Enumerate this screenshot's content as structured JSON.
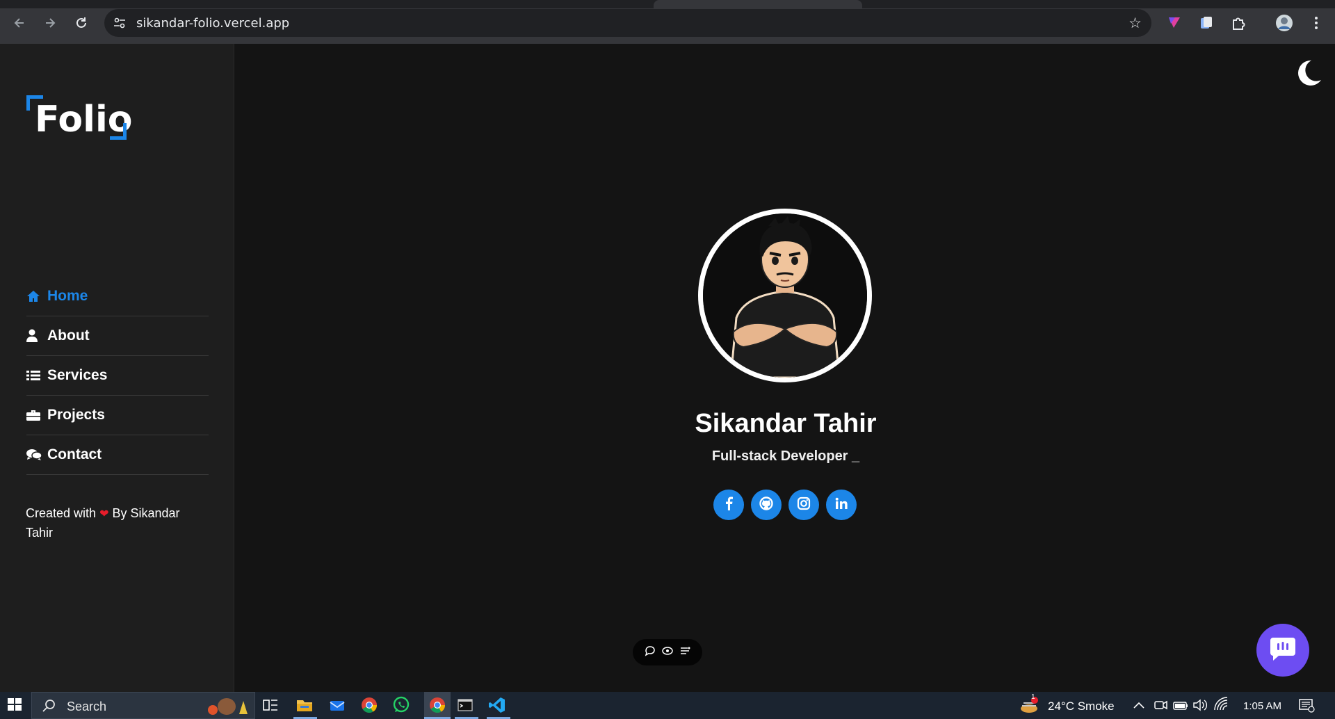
{
  "browser": {
    "url": "sikandar-folio.vercel.app"
  },
  "sidebar": {
    "logo": "Folio",
    "nav": [
      {
        "label": "Home",
        "icon": "home-icon",
        "active": true
      },
      {
        "label": "About",
        "icon": "user-icon",
        "active": false
      },
      {
        "label": "Services",
        "icon": "list-icon",
        "active": false
      },
      {
        "label": "Projects",
        "icon": "briefcase-icon",
        "active": false
      },
      {
        "label": "Contact",
        "icon": "comments-icon",
        "active": false
      }
    ],
    "footer_prefix": "Created with",
    "footer_suffix": "By Sikandar Tahir"
  },
  "hero": {
    "name": "Sikandar Tahir",
    "role": "Full-stack Developer _",
    "social": [
      "facebook-icon",
      "github-icon",
      "instagram-icon",
      "linkedin-icon"
    ]
  },
  "taskbar": {
    "search_placeholder": "Search",
    "weather": "24°C  Smoke",
    "time": "1:05 AM",
    "weather_badge": "1"
  },
  "colors": {
    "accent": "#1c86e8",
    "chat_fab": "#6d4df2",
    "page_bg": "#141414",
    "sidebar_bg": "#1e1e1e"
  }
}
